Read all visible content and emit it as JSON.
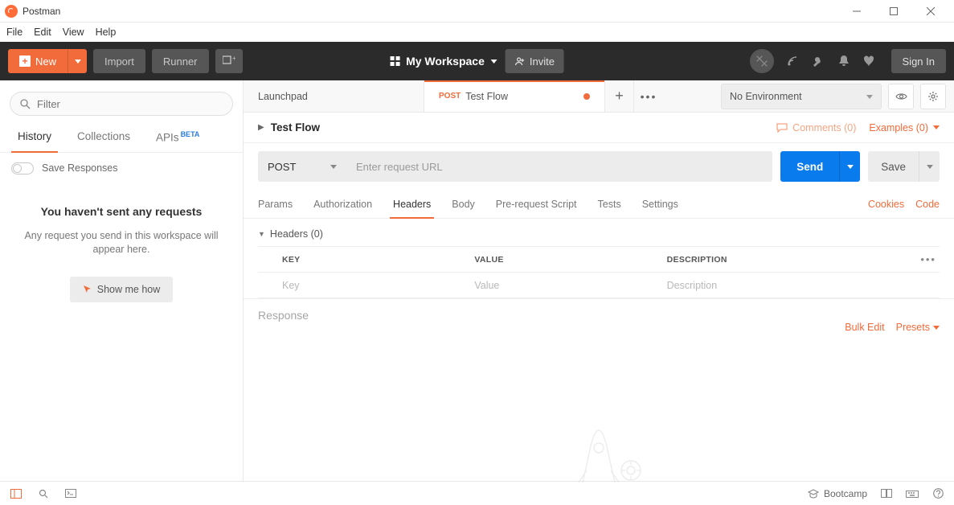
{
  "app": {
    "title": "Postman"
  },
  "menubar": {
    "file": "File",
    "edit": "Edit",
    "view": "View",
    "help": "Help"
  },
  "toolbar": {
    "new_label": "New",
    "import_label": "Import",
    "runner_label": "Runner",
    "workspace_label": "My Workspace",
    "invite_label": "Invite",
    "signin_label": "Sign In"
  },
  "sidebar": {
    "filter_placeholder": "Filter",
    "tabs": {
      "history": "History",
      "collections": "Collections",
      "apis": "APIs",
      "beta": "BETA"
    },
    "save_responses": "Save Responses",
    "empty_title": "You haven't sent any requests",
    "empty_body": "Any request you send in this workspace will appear here.",
    "show_me_how": "Show me how"
  },
  "tabs": {
    "launchpad": "Launchpad",
    "active": {
      "method": "POST",
      "name": "Test Flow"
    }
  },
  "environment": {
    "selected": "No Environment"
  },
  "request": {
    "title": "Test Flow",
    "comments_label": "Comments (0)",
    "examples_label": "Examples (0)",
    "method": "POST",
    "url_placeholder": "Enter request URL",
    "send_label": "Send",
    "save_label": "Save",
    "subtabs": {
      "params": "Params",
      "authorization": "Authorization",
      "headers": "Headers",
      "body": "Body",
      "prerequest": "Pre-request Script",
      "tests": "Tests",
      "settings": "Settings"
    },
    "cookies_label": "Cookies",
    "code_label": "Code",
    "headers_section_label": "Headers  (0)",
    "table": {
      "key": "KEY",
      "value": "VALUE",
      "description": "DESCRIPTION",
      "bulk_edit": "Bulk Edit",
      "presets": "Presets",
      "ph_key": "Key",
      "ph_value": "Value",
      "ph_description": "Description"
    }
  },
  "response": {
    "label": "Response"
  },
  "statusbar": {
    "bootcamp": "Bootcamp"
  }
}
